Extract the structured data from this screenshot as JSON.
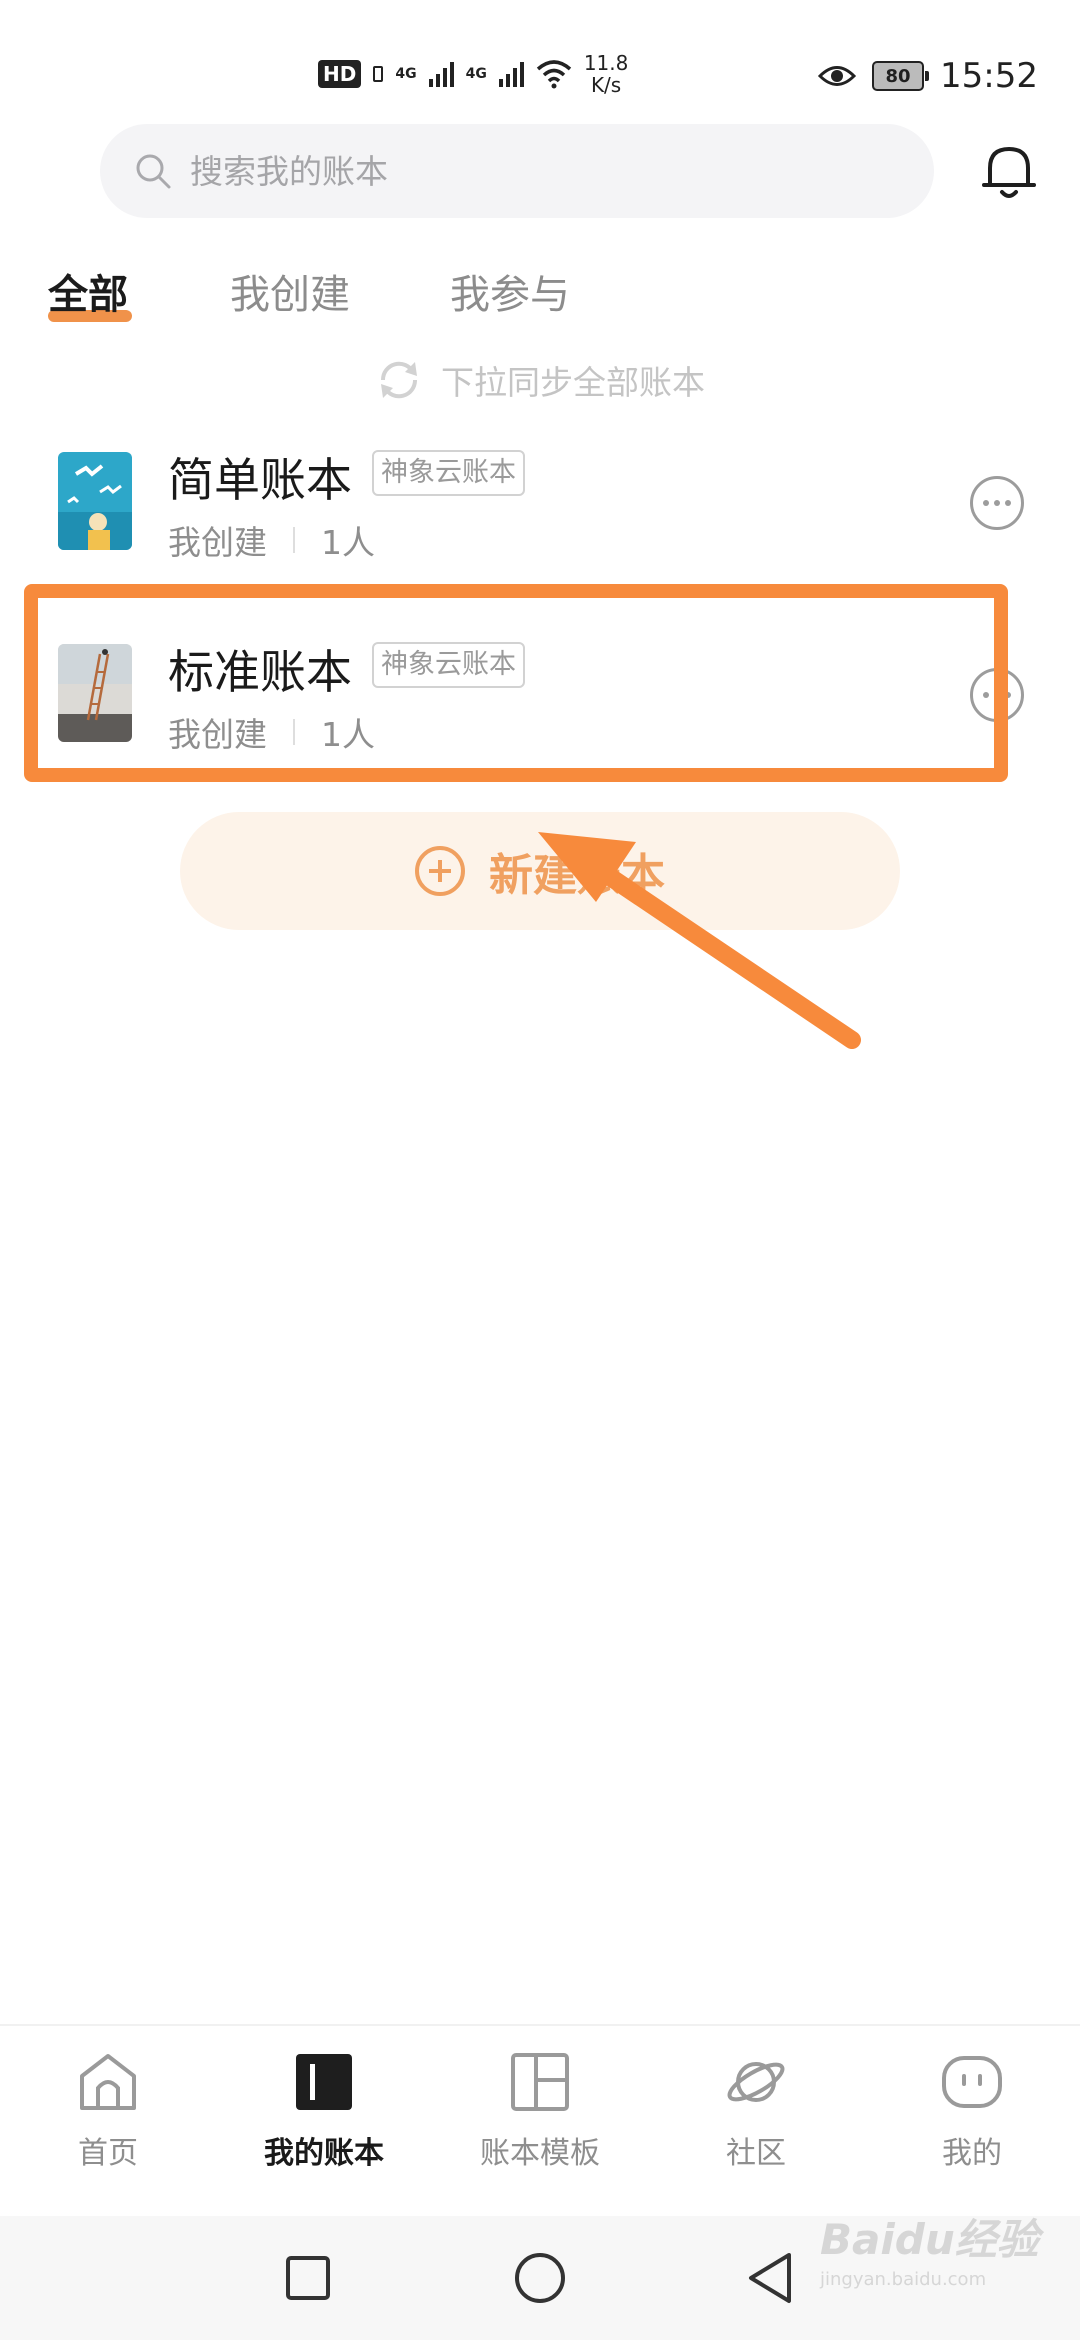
{
  "status_bar": {
    "hd": "HD",
    "net1": "4G",
    "net2": "4G",
    "speed_value": "11.8",
    "speed_unit": "K/s",
    "battery": "80",
    "time": "15:52"
  },
  "search": {
    "placeholder": "搜索我的账本"
  },
  "tabs": [
    {
      "label": "全部",
      "active": true
    },
    {
      "label": "我创建",
      "active": false
    },
    {
      "label": "我参与",
      "active": false
    }
  ],
  "sync_hint": "下拉同步全部账本",
  "books": [
    {
      "title": "简单账本",
      "tag": "神象云账本",
      "role": "我创建",
      "members": "1人",
      "cover": "seagull-illustration"
    },
    {
      "title": "标准账本",
      "tag": "神象云账本",
      "role": "我创建",
      "members": "1人",
      "cover": "ladder-wall-illustration"
    }
  ],
  "new_book_label": "新建账本",
  "bottom_nav": [
    {
      "label": "首页",
      "icon": "home-icon",
      "active": false
    },
    {
      "label": "我的账本",
      "icon": "book-icon",
      "active": true
    },
    {
      "label": "账本模板",
      "icon": "template-icon",
      "active": false
    },
    {
      "label": "社区",
      "icon": "planet-icon",
      "active": false
    },
    {
      "label": "我的",
      "icon": "profile-face-icon",
      "active": false
    }
  ],
  "colors": {
    "accent": "#f0924a",
    "highlight": "#f78a3c",
    "new_button_bg": "#fdf3e9",
    "new_button_text": "#f0a060"
  },
  "watermark": {
    "main": "Baidu经验",
    "sub": "jingyan.baidu.com"
  }
}
